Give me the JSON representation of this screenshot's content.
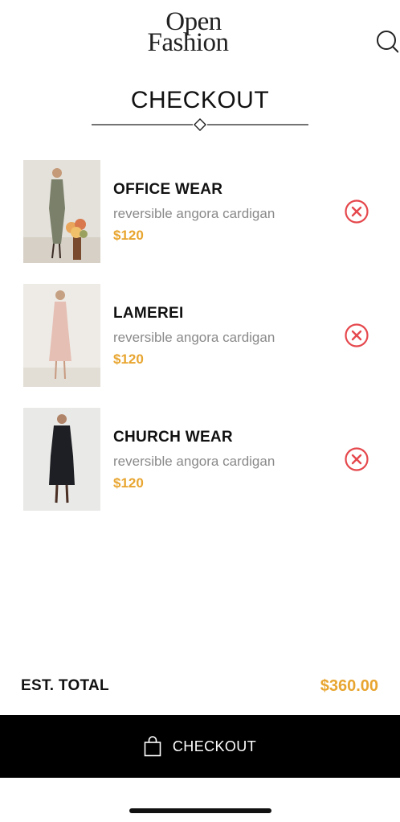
{
  "header": {
    "logo_line1": "Open",
    "logo_line2": "Fashion",
    "search_icon": "search-icon"
  },
  "page": {
    "title": "CHECKOUT"
  },
  "cart": {
    "items": [
      {
        "name": "OFFICE WEAR",
        "description": "reversible angora cardigan",
        "price": "$120",
        "remove_icon": "close-circle-icon"
      },
      {
        "name": "LAMEREI",
        "description": "reversible angora cardigan",
        "price": "$120",
        "remove_icon": "close-circle-icon"
      },
      {
        "name": "CHURCH WEAR",
        "description": "reversible angora cardigan",
        "price": "$120",
        "remove_icon": "close-circle-icon"
      }
    ]
  },
  "summary": {
    "total_label": "EST. TOTAL",
    "total_value": "$360.00"
  },
  "checkout_button": {
    "label": "CHECKOUT",
    "icon": "shopping-bag-icon"
  },
  "colors": {
    "accent": "#e8a530",
    "remove": "#e5484d",
    "bar": "#000000"
  }
}
